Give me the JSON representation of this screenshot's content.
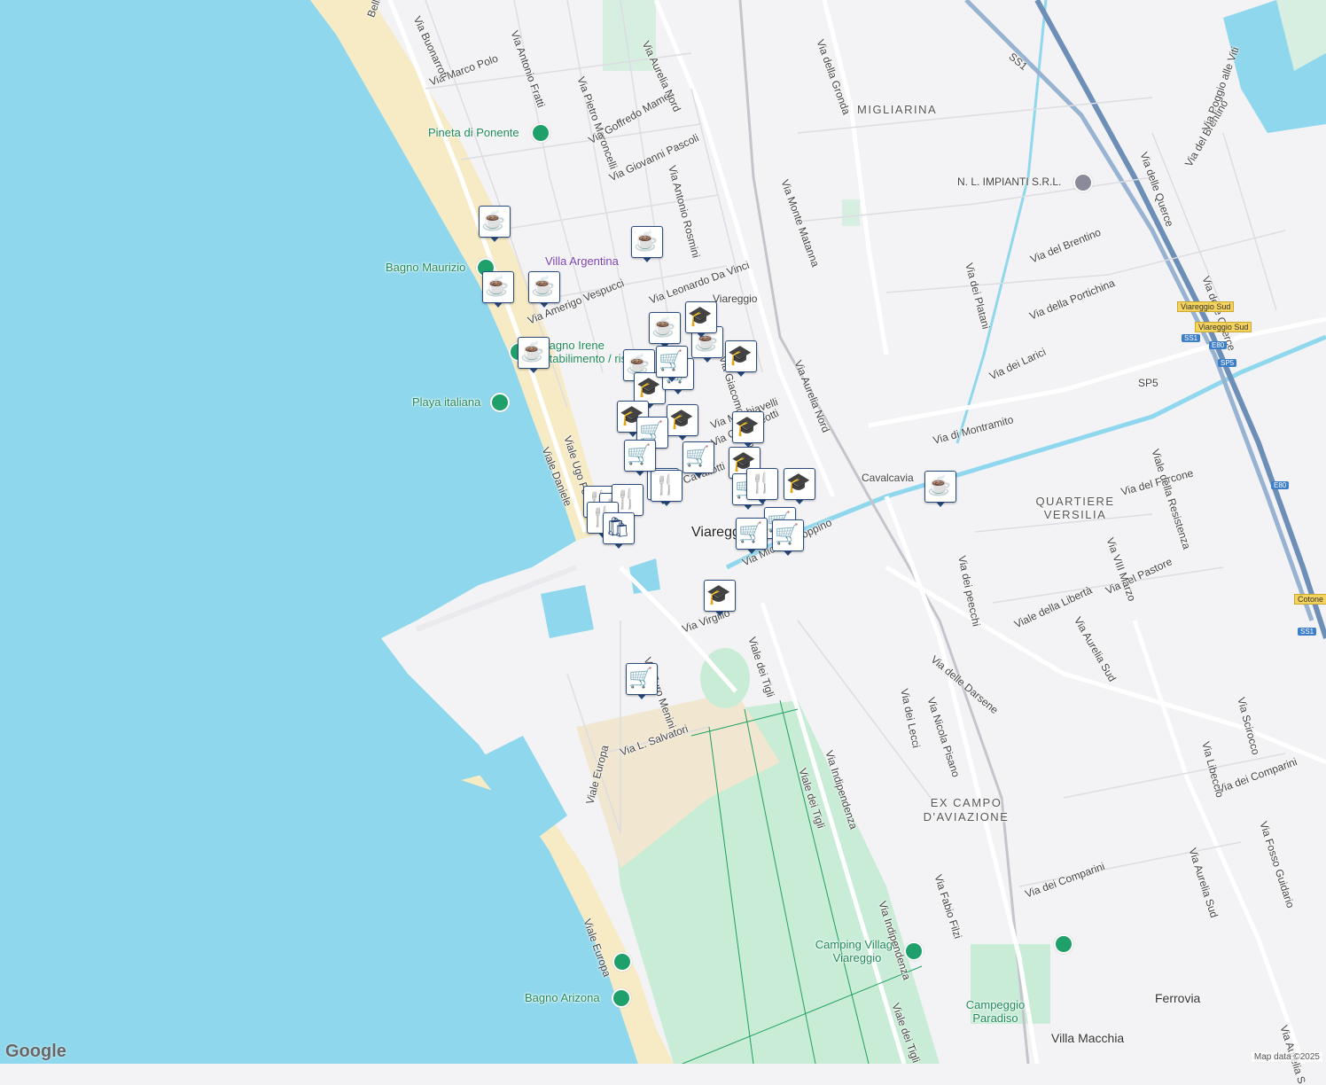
{
  "map": {
    "areas": [
      "MIGLIARINA",
      "QUARTIERE VERSILIA",
      "EX CAMPO D'AVIAZIONE"
    ],
    "city": "Viareggio",
    "places": [
      "Ferrovia",
      "Villa Macchia",
      "Cavalcavia",
      "Campeggio Paradiso",
      "Viareggio"
    ],
    "pois": {
      "pineta": "Pineta di Ponente",
      "bagno_maurizio": "Bagno Maurizio",
      "villa_argentina": "Villa Argentina",
      "bagno_irene": "Bagno Irene",
      "stabilimento": "Stabilimento / ris",
      "playa": "Playa italiana",
      "nl_impianti": "N. L. IMPIANTI S.R.L.",
      "camping": "Camping Village Viareggio",
      "bagno_arizona": "Bagno Arizona"
    },
    "streets": {
      "marco_polo": "Via Marco Polo",
      "buonarroti": "Via Buonarroti",
      "belluomini": "Belluomini",
      "fratti": "Via Antonio Fratti",
      "maroncelli": "Via Pietro Maroncelli",
      "mameli": "Via Goffredo Mameli",
      "pascoli": "Via Giovanni Pascoli",
      "aurelia_nord_top": "Via Aurelia Nord",
      "rosmini": "Via Antonio Rosmini",
      "gronda": "Via della Gronda",
      "monte_matanna": "Via Monte Matanna",
      "aurelia_nord": "Via Aurelia Nord",
      "da_vinci": "Via Leonardo Da Vinci",
      "vespucci": "Via Amerigo Vespucci",
      "puccini": "Via Giacomo Puccini",
      "ugo_foscolo": "Viale Ugo Foscolo",
      "daniele": "Viale Daniele",
      "machiavelli": "Via Machiavelli",
      "matteotti": "Via G. Matteotti",
      "cavallotti": "Cavallotti",
      "michele_coppino": "Via Michele Coppino",
      "virgilio": "Via Virgilio",
      "euro_menini": "Via Euro Menini",
      "tigli_n": "Viale dei Tigli",
      "tigli_s": "Viale dei Tigli",
      "tigli_bottom": "Viale dei Tigli",
      "salvatori": "Via L. Salvatori",
      "europa": "Viale Europa",
      "europa_s": "Viale Europa",
      "indipendenza": "Via Indipendenza",
      "indipendenza_s": "Via Indipendenza",
      "lecci": "Via dei Lecci",
      "nicola_pisano": "Via Nicola Pisano",
      "darsene": "Via delle Darsene",
      "fabio_filzi": "Via Fabio Filzi",
      "comparini": "Via dei Comparini",
      "comparini_e": "Via dei Comparini",
      "platani": "Via dei Platani",
      "brentino": "Via del Brentino",
      "portichina": "Via della Portichina",
      "larici": "Via dei Larici",
      "montramito": "Via di Montramito",
      "peecchi": "Via dei peecchi",
      "liberta": "Viale della Libertà",
      "aurelia_sud": "Via Aurelia Sud",
      "aurelia_sud_e": "Via Aurelia Sud",
      "aurelia_sud_far": "Via Aurelia S",
      "pastore": "Via del Pastore",
      "viii_marzo": "Via VIII Marzo",
      "forcone": "Via del Forcone",
      "resistenza": "Viale della Resistenza",
      "querce": "Via delle Querce",
      "querce2": "Via delle Querce",
      "brentino_e": "Via del Brentino",
      "poggio": "Via Poggio alle Viti",
      "scirocco": "Via Scirocco",
      "libeccio": "Via Libeccio",
      "fosso": "Via Fosso Guidario",
      "ss1_top": "SS1",
      "sp5": "SP5"
    },
    "shields": {
      "viareggio_sud1": "Viareggio Sud",
      "viareggio_sud2": "Viareggio Sud",
      "cotone": "Cotone",
      "ss1": "SS1",
      "e80": "E80",
      "sp5": "SP5",
      "e80b": "E80",
      "ss1b": "SS1"
    },
    "credit": "Map data ©2025",
    "logo": "Google"
  },
  "markers": [
    {
      "type": "cafe",
      "icon": "☕"
    },
    {
      "type": "cafe",
      "icon": "☕"
    },
    {
      "type": "cafe",
      "icon": "☕"
    },
    {
      "type": "cafe",
      "icon": "☕"
    },
    {
      "type": "cafe",
      "icon": "☕"
    },
    {
      "type": "cafe",
      "icon": "☕"
    },
    {
      "type": "cafe",
      "icon": "☕"
    },
    {
      "type": "cafe",
      "icon": "☕"
    },
    {
      "type": "cafe",
      "icon": "☕"
    },
    {
      "type": "school",
      "icon": "🎓"
    },
    {
      "type": "school",
      "icon": "🎓"
    },
    {
      "type": "school",
      "icon": "🎓"
    },
    {
      "type": "school",
      "icon": "🎓"
    },
    {
      "type": "school",
      "icon": "🎓"
    },
    {
      "type": "school",
      "icon": "🎓"
    },
    {
      "type": "school",
      "icon": "🎓"
    },
    {
      "type": "school",
      "icon": "🎓"
    },
    {
      "type": "school",
      "icon": "🎓"
    },
    {
      "type": "grocery",
      "icon": "🛒"
    },
    {
      "type": "grocery",
      "icon": "🛒"
    },
    {
      "type": "grocery",
      "icon": "🛒"
    },
    {
      "type": "grocery",
      "icon": "🛒"
    },
    {
      "type": "grocery",
      "icon": "🛒"
    },
    {
      "type": "grocery",
      "icon": "🛒"
    },
    {
      "type": "grocery",
      "icon": "🛒"
    },
    {
      "type": "grocery",
      "icon": "🛒"
    },
    {
      "type": "grocery",
      "icon": "🛒"
    },
    {
      "type": "restaurant",
      "icon": "🍴"
    },
    {
      "type": "restaurant",
      "icon": "🍴"
    },
    {
      "type": "restaurant",
      "icon": "🍴"
    },
    {
      "type": "restaurant",
      "icon": "🍴"
    },
    {
      "type": "restaurant",
      "icon": "🍴"
    },
    {
      "type": "shopping",
      "icon": "🛍"
    },
    {
      "type": "shopping",
      "icon": "🛍"
    },
    {
      "type": "restaurant",
      "icon": "🍴"
    },
    {
      "type": "grocery",
      "icon": "🛒"
    }
  ]
}
